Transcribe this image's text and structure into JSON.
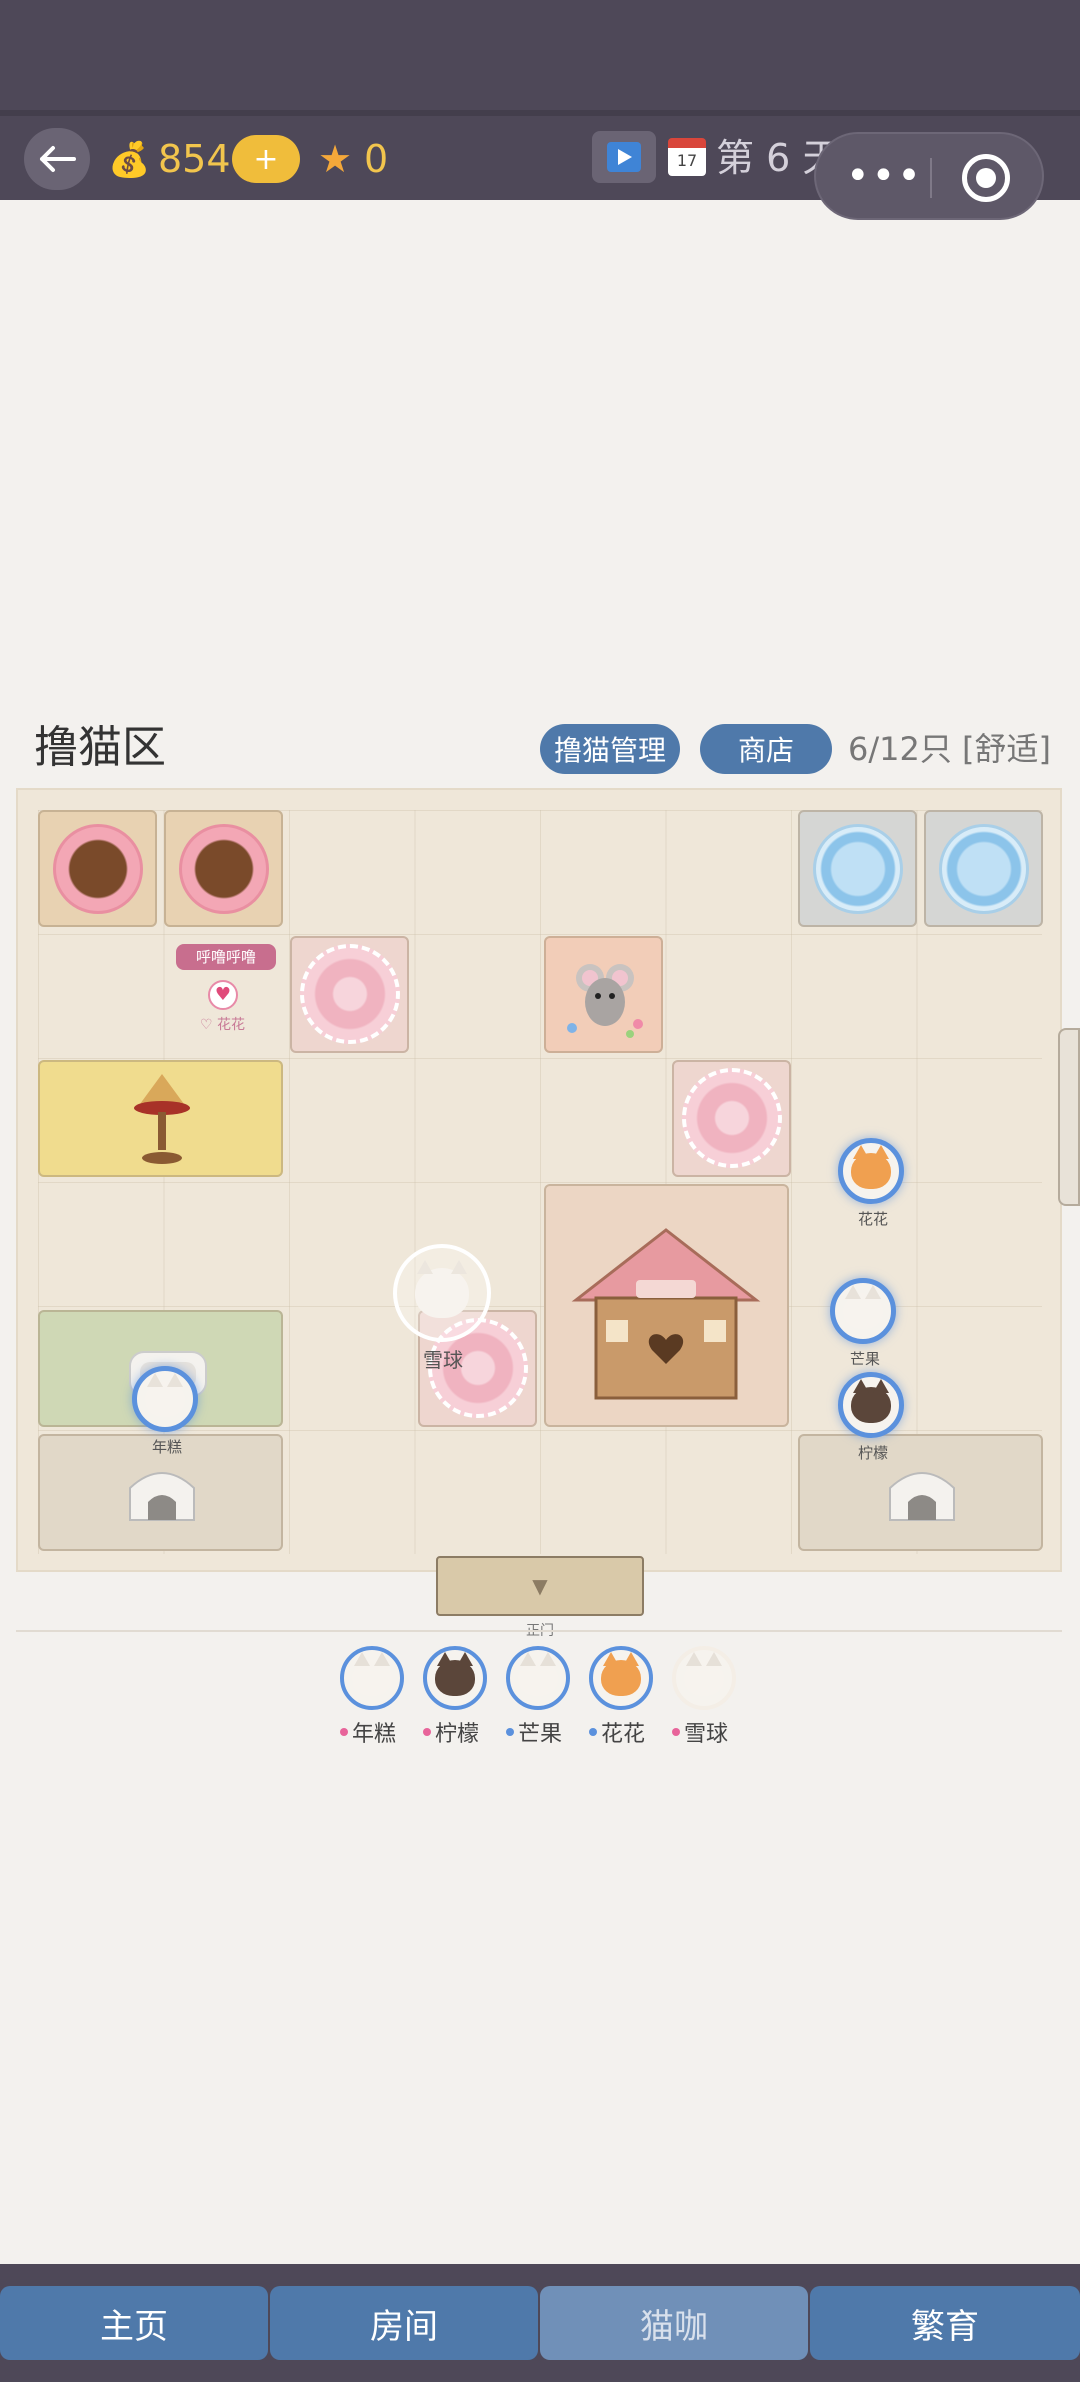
{
  "topbar": {
    "money": "854",
    "plus_label": "+",
    "stars": "0",
    "calendar_day": "17",
    "day_label": "第 6 天"
  },
  "area": {
    "title": "撸猫区",
    "manage_label": "撸猫管理",
    "shop_label": "商店",
    "capacity": "6/12只 [舒适]"
  },
  "room": {
    "bubble_text": "呼噜呼噜",
    "bubble_cat": "♡ 花花",
    "selected_cat": "雪球",
    "door_arrow": "▼",
    "door_label": "正门",
    "cats_on_map": [
      {
        "name": "花花"
      },
      {
        "name": "芒果"
      },
      {
        "name": "柠檬"
      },
      {
        "name": "年糕"
      }
    ]
  },
  "roster": [
    {
      "name": "年糕",
      "dot_color": "#e8649a",
      "face_color": "#f7f3ee",
      "ring": "#5b91dd"
    },
    {
      "name": "柠檬",
      "dot_color": "#e8649a",
      "face_color": "#5b463a",
      "ring": "#5b91dd"
    },
    {
      "name": "芒果",
      "dot_color": "#5b91dd",
      "face_color": "#f7f3ee",
      "ring": "#5b91dd"
    },
    {
      "name": "花花",
      "dot_color": "#5b91dd",
      "face_color": "#f0a050",
      "ring": "#5b91dd"
    },
    {
      "name": "雪球",
      "dot_color": "#e8649a",
      "face_color": "#f7f3ee",
      "ring": "#f4eee6"
    }
  ],
  "nav": {
    "home": "主页",
    "rooms": "房间",
    "cafe": "猫咖",
    "breed": "繁育"
  },
  "colors": {
    "accent": "#4f79aa",
    "nav_active": "#4f79aa",
    "nav_inactive": "#7090b8",
    "gold": "#f2c54d"
  }
}
